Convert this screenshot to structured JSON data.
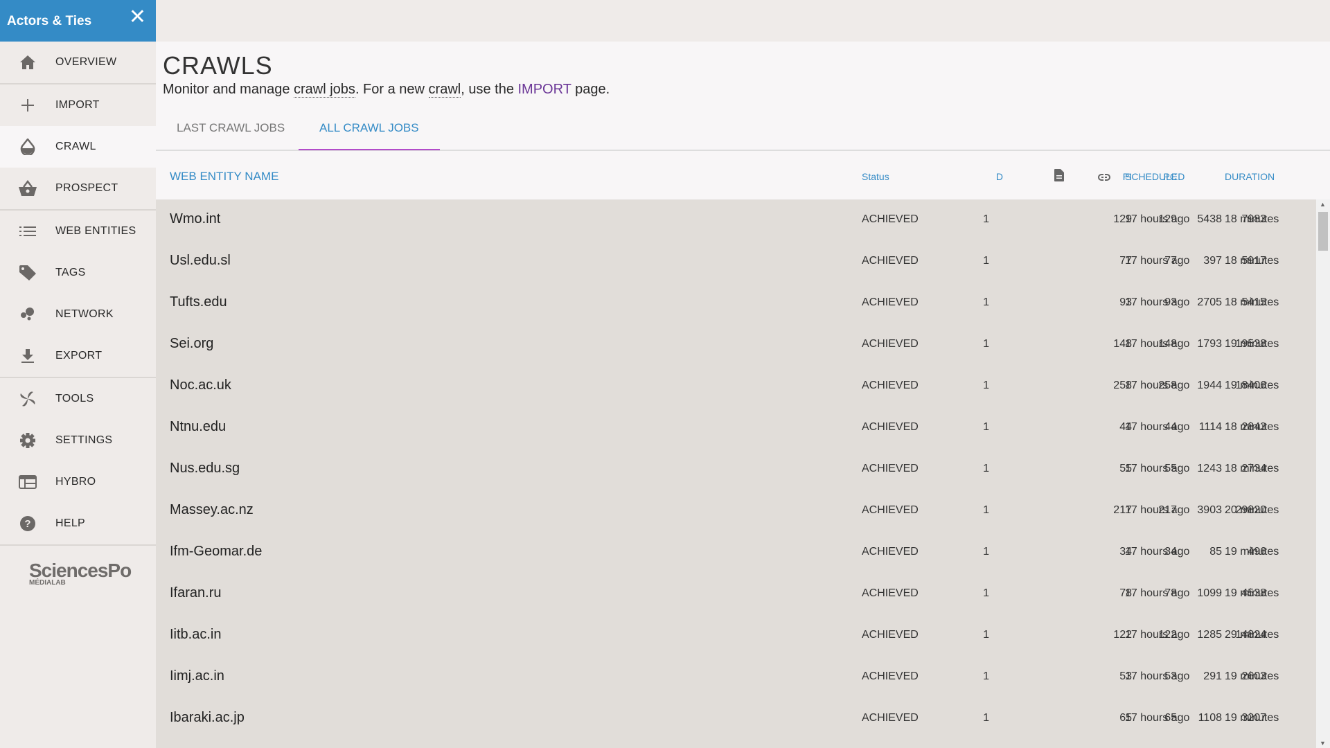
{
  "app": {
    "title": "Actors & Ties",
    "close_icon": "close-icon"
  },
  "sidebar": {
    "items": [
      {
        "label": "OVERVIEW",
        "icon": "home-icon"
      },
      {
        "label": "IMPORT",
        "icon": "plus-icon"
      },
      {
        "label": "CRAWL",
        "icon": "drop-icon",
        "active": true
      },
      {
        "label": "PROSPECT",
        "icon": "basket-icon"
      },
      {
        "label": "WEB ENTITIES",
        "icon": "list-icon"
      },
      {
        "label": "TAGS",
        "icon": "tag-icon"
      },
      {
        "label": "NETWORK",
        "icon": "network-icon"
      },
      {
        "label": "EXPORT",
        "icon": "download-icon"
      },
      {
        "label": "TOOLS",
        "icon": "pinwheel-icon"
      },
      {
        "label": "SETTINGS",
        "icon": "gear-icon"
      },
      {
        "label": "HYBRO",
        "icon": "hybro-icon"
      },
      {
        "label": "HELP",
        "icon": "help-icon"
      }
    ],
    "logo": {
      "name": "SciencesPo",
      "sub": "MÉDIALAB"
    }
  },
  "page": {
    "title": "CRAWLS",
    "sub1": "Monitor and manage ",
    "sub_crawl_jobs": "crawl jobs",
    "sub2": ". For a new ",
    "sub_crawl": "crawl",
    "sub3": ", use the ",
    "sub_import": "IMPORT",
    "sub4": " page."
  },
  "tabs": [
    {
      "label": "LAST CRAWL JOBS"
    },
    {
      "label": "ALL CRAWL JOBS",
      "active": true
    }
  ],
  "table": {
    "headers": {
      "name": "WEB ENTITY NAME",
      "d": "D",
      "status": "Status",
      "pi": "PI",
      "pc": "PC",
      "pages_icon": "document-icon",
      "links_icon": "link-icon",
      "scheduled": "SCHEDULED",
      "duration": "DURATION"
    },
    "rows": [
      [
        "Wmo.int",
        "1",
        "ACHIEVED",
        "129",
        "129",
        "5438",
        "7983",
        "17 hours ago",
        "18 minutes"
      ],
      [
        "Usl.edu.sl",
        "1",
        "ACHIEVED",
        "77",
        "77",
        "397",
        "5917",
        "17 hours ago",
        "18 minutes"
      ],
      [
        "Tufts.edu",
        "1",
        "ACHIEVED",
        "93",
        "93",
        "2705",
        "5415",
        "17 hours ago",
        "18 minutes"
      ],
      [
        "Sei.org",
        "1",
        "ACHIEVED",
        "148",
        "148",
        "1793",
        "19538",
        "17 hours ago",
        "19 minutes"
      ],
      [
        "Noc.ac.uk",
        "1",
        "ACHIEVED",
        "258",
        "258",
        "1944",
        "18406",
        "17 hours ago",
        "19 minutes"
      ],
      [
        "Ntnu.edu",
        "1",
        "ACHIEVED",
        "44",
        "44",
        "1114",
        "2843",
        "17 hours ago",
        "18 minutes"
      ],
      [
        "Nus.edu.sg",
        "1",
        "ACHIEVED",
        "55",
        "55",
        "1243",
        "2734",
        "17 hours ago",
        "18 minutes"
      ],
      [
        "Massey.ac.nz",
        "1",
        "ACHIEVED",
        "217",
        "217",
        "3903",
        "29820",
        "17 hours ago",
        "20 minutes"
      ],
      [
        "Ifm-Geomar.de",
        "1",
        "ACHIEVED",
        "34",
        "34",
        "85",
        "496",
        "17 hours ago",
        "19 minutes"
      ],
      [
        "Ifaran.ru",
        "1",
        "ACHIEVED",
        "78",
        "78",
        "1099",
        "4538",
        "17 hours ago",
        "19 minutes"
      ],
      [
        "Iitb.ac.in",
        "1",
        "ACHIEVED",
        "122",
        "122",
        "1285",
        "14824",
        "17 hours ago",
        "29 minutes"
      ],
      [
        "Iimj.ac.in",
        "1",
        "ACHIEVED",
        "53",
        "53",
        "291",
        "2603",
        "17 hours ago",
        "19 minutes"
      ],
      [
        "Ibaraki.ac.jp",
        "1",
        "ACHIEVED",
        "65",
        "65",
        "1108",
        "3207",
        "17 hours ago",
        "19 minutes"
      ]
    ]
  },
  "colors": {
    "brand": "#348bc6",
    "tab_underline": "#b24bc9",
    "link": "#6a3596"
  }
}
